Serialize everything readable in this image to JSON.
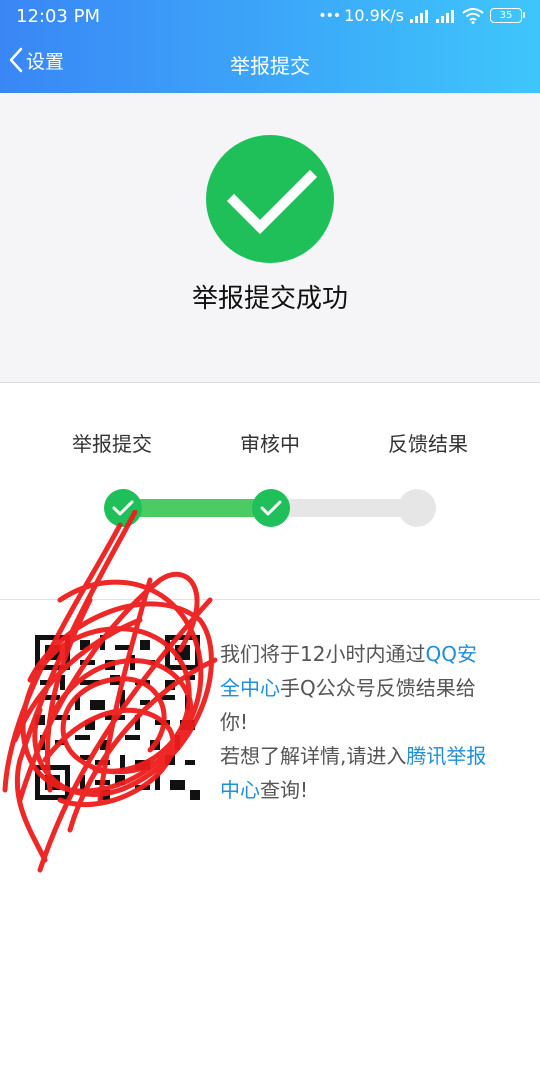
{
  "status_bar": {
    "time": "12:03 PM",
    "net_speed": "10.9K/s",
    "battery": "35"
  },
  "nav": {
    "back_label": "设置",
    "title": "举报提交"
  },
  "result": {
    "title": "举报提交成功",
    "icon": "check-circle-icon",
    "color": "#1fc05a"
  },
  "progress": {
    "steps": [
      {
        "label": "举报提交",
        "state": "done"
      },
      {
        "label": "审核中",
        "state": "done"
      },
      {
        "label": "反馈结果",
        "state": "pending"
      }
    ],
    "active_color": "#4ccb64",
    "inactive_color": "#e6e6e6"
  },
  "info": {
    "line1_a": "我们将于12小时内通过",
    "link1": "QQ安全中心",
    "line1_b": "手Q公众号反馈结果给你!",
    "line2_a": "若想了解详情,请进入",
    "link2": "腾讯举报中心",
    "line2_b": "查询!",
    "link_color": "#1e8fd8"
  },
  "header_gradient": [
    "#3a86f6",
    "#3ec6fb"
  ]
}
